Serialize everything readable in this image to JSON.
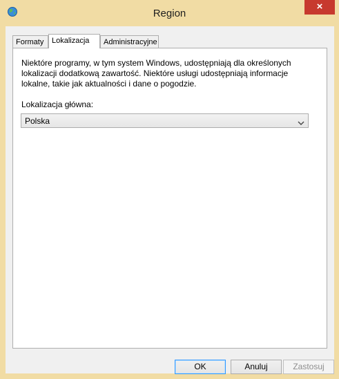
{
  "window": {
    "title": "Region",
    "close_label": "×"
  },
  "tabs": [
    {
      "label": "Formaty"
    },
    {
      "label": "Lokalizacja"
    },
    {
      "label": "Administracyjne"
    }
  ],
  "active_tab": "Lokalizacja",
  "location": {
    "description_lines": [
      "Niektóre programy, w tym system Windows, udostępniają dla określonych",
      "lokalizacji dodatkową zawartość. Niektóre usługi udostępniają informacje",
      "lokalne, takie jak aktualności i dane o pogodzie."
    ],
    "home_location_label": "Lokalizacja główna:",
    "home_location_value": "Polska"
  },
  "buttons": {
    "ok": "OK",
    "cancel": "Anuluj",
    "apply": "Zastosuj"
  },
  "colors": {
    "title_bar": "#f1dca4",
    "close_button": "#c7392e",
    "default_button_border": "#3399ff"
  },
  "icons": {
    "window": "globe-region-icon",
    "dropdown": "chevron-down-icon"
  }
}
